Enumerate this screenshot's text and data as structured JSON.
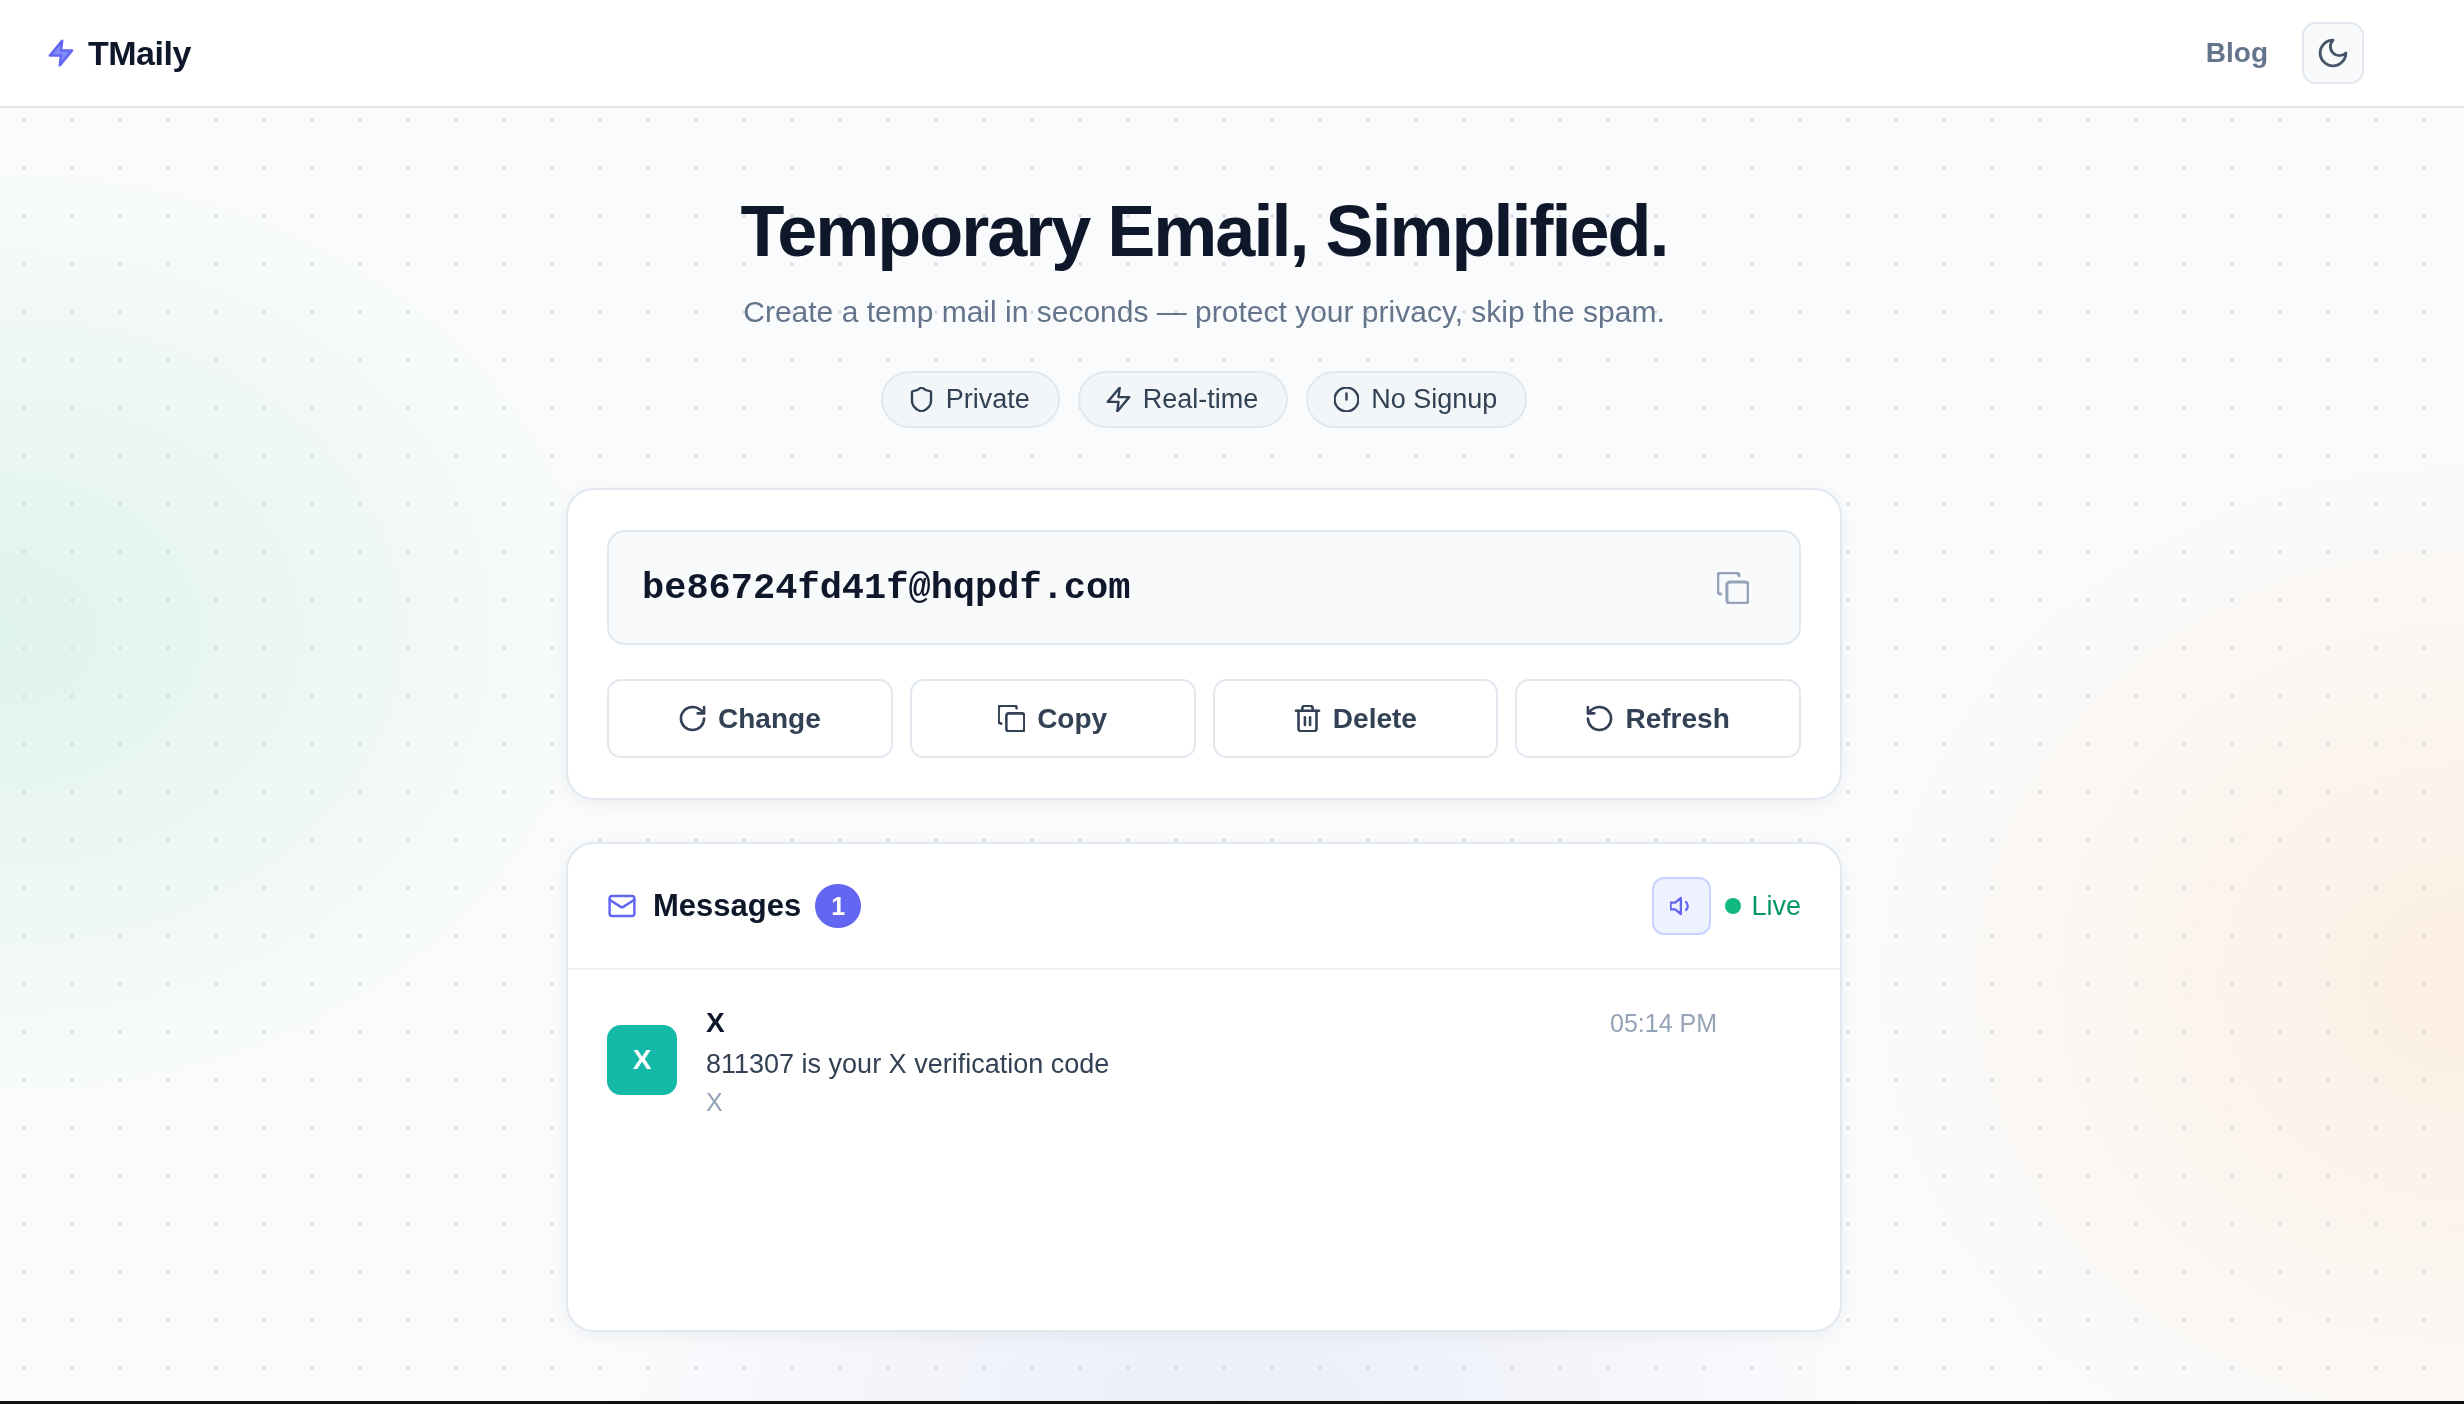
{
  "header": {
    "logo": "TMaily",
    "nav": [
      {
        "label": "Blog"
      }
    ]
  },
  "hero": {
    "title": "Temporary Email, Simplified.",
    "subtitle": "Create a temp mail in seconds — protect your privacy, skip the spam.",
    "features": [
      "Private",
      "Real-time",
      "No Signup"
    ]
  },
  "mailbox": {
    "address": "be86724fd41f@hqpdf.com",
    "actions": [
      "Change",
      "Copy",
      "Delete",
      "Refresh"
    ]
  },
  "inbox": {
    "title": "Messages",
    "count": "1",
    "sound": {
      "on": true
    },
    "status": "Live",
    "messages": [
      {
        "initial": "X",
        "color": "#14b8a6",
        "sender": "X",
        "subject": "811307 is your X verification code",
        "preview": "X",
        "time": "05:14 PM"
      }
    ]
  }
}
